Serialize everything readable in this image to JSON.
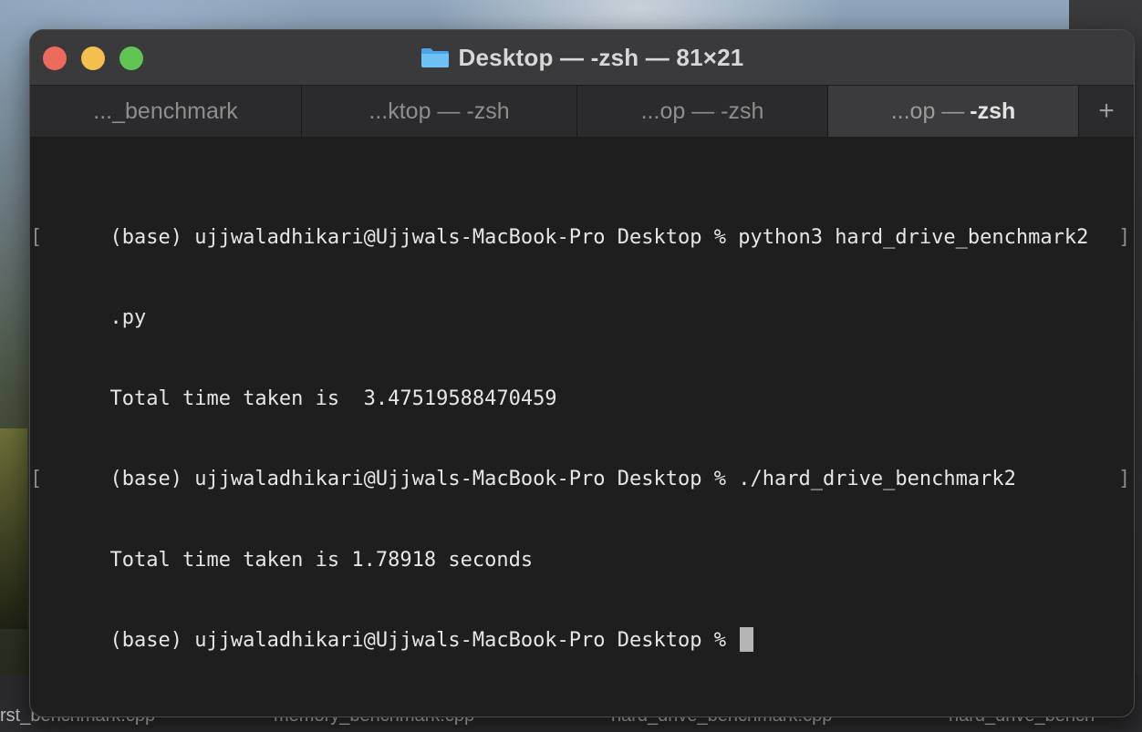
{
  "window": {
    "title": "Desktop — -zsh — 81×21",
    "colors": {
      "close": "#ed6a5e",
      "minimize": "#f4bf4f",
      "zoom": "#61c554",
      "background": "#1e1e1e",
      "text": "#e6e6e6"
    }
  },
  "tabs": [
    {
      "label": "..._benchmark",
      "active": false
    },
    {
      "label": "...ktop — -zsh",
      "active": false
    },
    {
      "label": "...op — -zsh",
      "active": false
    },
    {
      "prefix": "...op — ",
      "label": "-zsh",
      "active": true
    }
  ],
  "new_tab_label": "+",
  "terminal": {
    "lines": [
      "(base) ujjwaladhikari@Ujjwals-MacBook-Pro Desktop % python3 hard_drive_benchmark2",
      ".py",
      "Total time taken is  3.47519588470459",
      "(base) ujjwaladhikari@Ujjwals-MacBook-Pro Desktop % ./hard_drive_benchmark2",
      "Total time taken is 1.78918 seconds",
      "(base) ujjwaladhikari@Ujjwals-MacBook-Pro Desktop % "
    ],
    "mark_open": "[",
    "mark_close": "]"
  },
  "dock_labels": [
    "rst_benchmark.cpp",
    "memory_benchmark.cpp",
    "hard_drive_benchmark.cpp",
    "hard_drive_bench"
  ],
  "icons": [
    "folder-icon",
    "close-button",
    "minimize-button",
    "zoom-button",
    "cursor-block"
  ]
}
